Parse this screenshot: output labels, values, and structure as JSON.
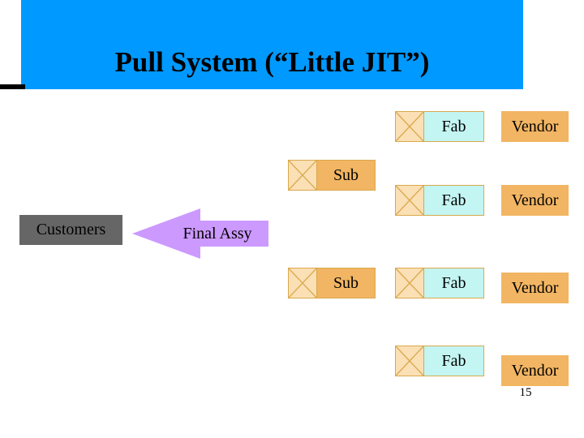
{
  "slide": {
    "title": "Pull System (“Little JIT”)",
    "page_number": "15",
    "colors": {
      "title_bar": "#0099FF",
      "title_text": "#000000",
      "rule": "#000000",
      "kanban_fill": "#FBDFB5",
      "kanban_border": "#D9A94C",
      "fab_fill": "#C3F5F2",
      "sub_fill": "#F2B563",
      "vendor_fill": "#F2B563",
      "customers_fill": "#666666",
      "arrow_fill": "#CC99FF",
      "page_background": "#FFFFFF"
    }
  },
  "customers": {
    "label": "Customers"
  },
  "final_assembly": {
    "label": "Final Assy",
    "direction": "left"
  },
  "nodes": [
    {
      "label": "Fab",
      "kind": "fab",
      "icon": "kanban-card-icon",
      "row": 1
    },
    {
      "label": "Sub",
      "kind": "sub",
      "icon": "kanban-card-icon",
      "row": 2
    },
    {
      "label": "Fab",
      "kind": "fab",
      "icon": "kanban-card-icon",
      "row": 3
    },
    {
      "label": "Sub",
      "kind": "sub",
      "icon": "kanban-card-icon",
      "row": 4
    },
    {
      "label": "Fab",
      "kind": "fab",
      "icon": "kanban-card-icon",
      "row": 4
    },
    {
      "label": "Fab",
      "kind": "fab",
      "icon": "kanban-card-icon",
      "row": 5
    }
  ],
  "vendors": [
    {
      "label": "Vendor"
    },
    {
      "label": "Vendor"
    },
    {
      "label": "Vendor"
    },
    {
      "label": "Vendor"
    }
  ]
}
